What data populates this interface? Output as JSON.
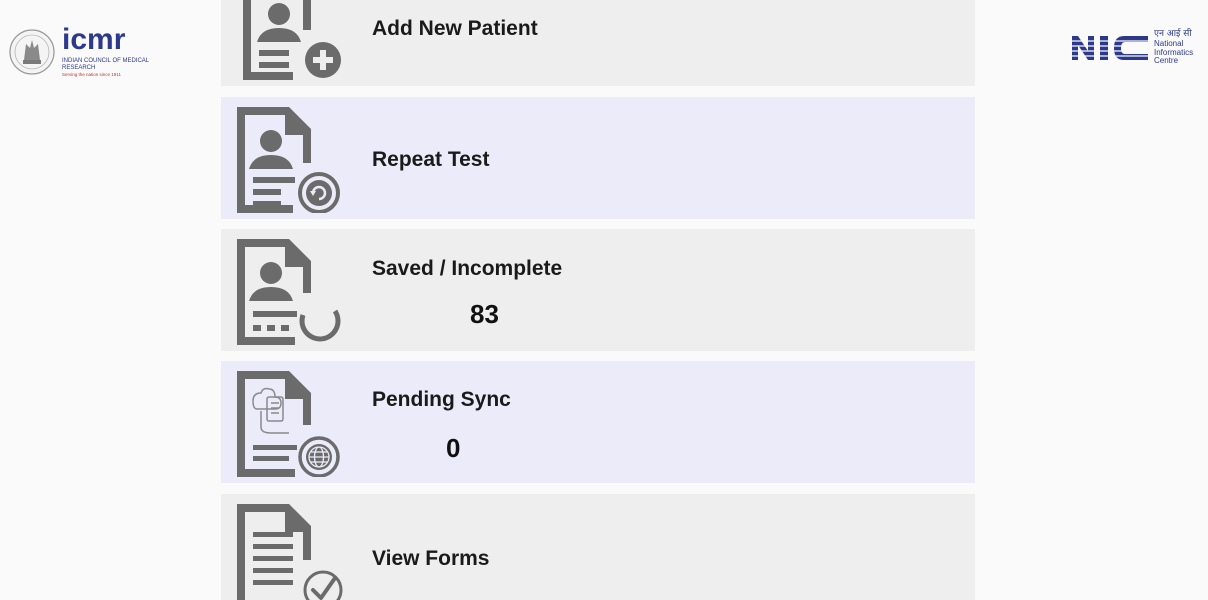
{
  "header": {
    "left_logo": {
      "wordmark": "icmr",
      "subtitle": "INDIAN COUNCIL OF MEDICAL RESEARCH",
      "tagline": "Serving the nation since 1911",
      "icon": "ashoka-emblem-icon",
      "color": "#2d3a8c",
      "accent": "#e07b1f"
    },
    "right_logo": {
      "wordmark": "NIC",
      "hindi": "एन आई सी",
      "line1": "National",
      "line2": "Informatics",
      "line3": "Centre",
      "color": "#2d3a8c"
    }
  },
  "menu": {
    "items": [
      {
        "label": "Add New Patient",
        "icon": "add-patient-icon",
        "count": null
      },
      {
        "label": "Repeat Test",
        "icon": "repeat-test-icon",
        "count": null
      },
      {
        "label": "Saved / Incomplete",
        "icon": "saved-incomplete-icon",
        "count": "83"
      },
      {
        "label": "Pending Sync",
        "icon": "pending-sync-icon",
        "count": "0"
      },
      {
        "label": "View Forms",
        "icon": "view-forms-icon",
        "count": null
      }
    ]
  },
  "colors": {
    "page_bg": "#fafafa",
    "card_bg": "#eeeeee",
    "card_alt_bg": "#ecebf9",
    "icon_color": "#6b6b6b"
  }
}
